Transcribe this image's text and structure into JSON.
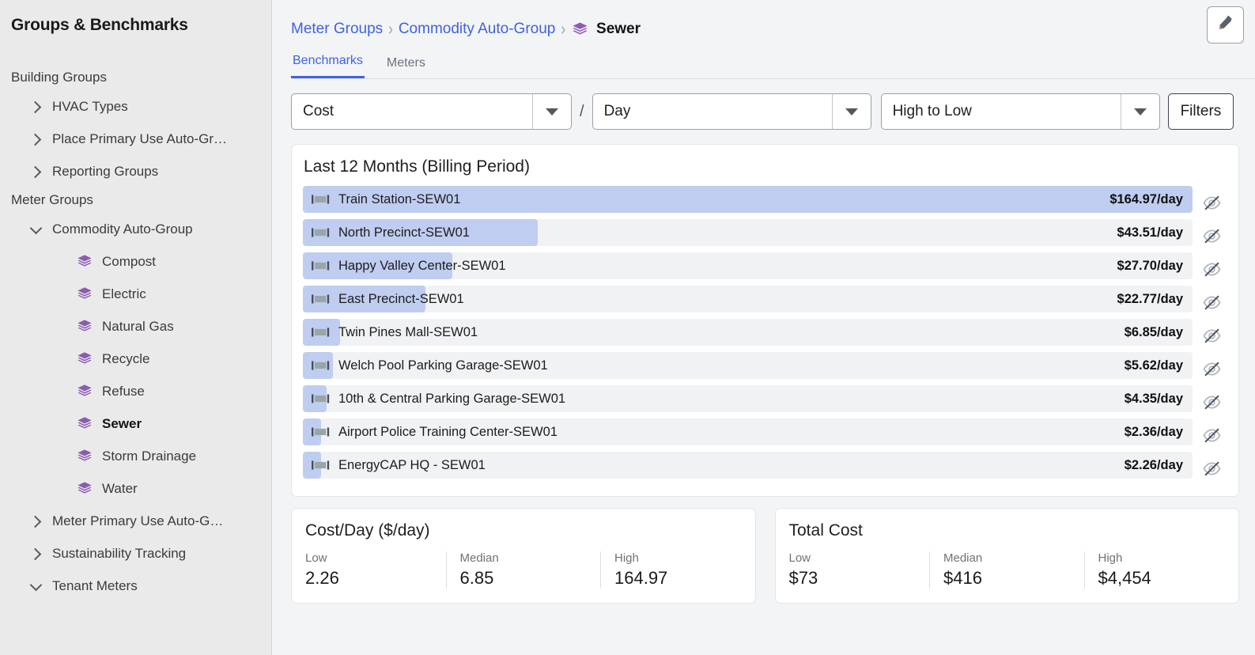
{
  "sidebar": {
    "title": "Groups & Benchmarks",
    "sections": [
      {
        "label": "Building Groups",
        "items": [
          {
            "label": "HVAC Types",
            "state": "collapsed",
            "level": 1
          },
          {
            "label": "Place Primary Use Auto-Gr…",
            "state": "collapsed",
            "level": 1
          },
          {
            "label": "Reporting Groups",
            "state": "collapsed",
            "level": 1
          }
        ]
      },
      {
        "label": "Meter Groups",
        "items": [
          {
            "label": "Commodity Auto-Group",
            "state": "expanded",
            "level": 1
          },
          {
            "label": "Compost",
            "state": "leaf",
            "level": 2
          },
          {
            "label": "Electric",
            "state": "leaf",
            "level": 2
          },
          {
            "label": "Natural Gas",
            "state": "leaf",
            "level": 2
          },
          {
            "label": "Recycle",
            "state": "leaf",
            "level": 2
          },
          {
            "label": "Refuse",
            "state": "leaf",
            "level": 2
          },
          {
            "label": "Sewer",
            "state": "leaf",
            "level": 2,
            "active": true
          },
          {
            "label": "Storm Drainage",
            "state": "leaf",
            "level": 2
          },
          {
            "label": "Water",
            "state": "leaf",
            "level": 2
          },
          {
            "label": "Meter Primary Use Auto-G…",
            "state": "collapsed",
            "level": 1
          },
          {
            "label": "Sustainability Tracking",
            "state": "collapsed",
            "level": 1
          },
          {
            "label": "Tenant Meters",
            "state": "expanded",
            "level": 1
          }
        ]
      }
    ]
  },
  "breadcrumb": {
    "items": [
      "Meter Groups",
      "Commodity Auto-Group"
    ],
    "separator": "›",
    "current": "Sewer"
  },
  "header": {
    "edit_icon": "pencil-icon"
  },
  "tabs": [
    {
      "label": "Benchmarks",
      "active": true
    },
    {
      "label": "Meters",
      "active": false
    }
  ],
  "controls": {
    "metric": "Cost",
    "divider": "/",
    "period": "Day",
    "sort": "High to Low",
    "filters_label": "Filters"
  },
  "benchmark_card": {
    "title": "Last 12 Months (Billing Period)"
  },
  "chart_data": {
    "type": "bar",
    "orientation": "horizontal",
    "title": "Last 12 Months (Billing Period)",
    "xlabel": "",
    "ylabel": "",
    "unit": "$/day",
    "sort": "High to Low",
    "categories": [
      "Train Station-SEW01",
      "North Precinct-SEW01",
      "Happy Valley Center-SEW01",
      "East Precinct-SEW01",
      "Twin Pines Mall-SEW01",
      "Welch Pool Parking Garage-SEW01",
      "10th & Central Parking Garage-SEW01",
      "Airport Police Training Center-SEW01",
      "EnergyCAP HQ - SEW01"
    ],
    "values": [
      164.97,
      43.51,
      27.7,
      22.77,
      6.85,
      5.62,
      4.35,
      2.36,
      2.26
    ],
    "value_labels": [
      "$164.97/day",
      "$43.51/day",
      "$27.70/day",
      "$22.77/day",
      "$6.85/day",
      "$5.62/day",
      "$4.35/day",
      "$2.36/day",
      "$2.26/day"
    ],
    "xlim": [
      0,
      164.97
    ],
    "grid": false,
    "legend": false,
    "bar_color": "#bfcdf0",
    "row_color": "#f1f2f4"
  },
  "stat_cards": [
    {
      "title": "Cost/Day ($/day)",
      "cols": [
        {
          "label": "Low",
          "value": "2.26"
        },
        {
          "label": "Median",
          "value": "6.85"
        },
        {
          "label": "High",
          "value": "164.97"
        }
      ]
    },
    {
      "title": "Total Cost",
      "cols": [
        {
          "label": "Low",
          "value": "$73"
        },
        {
          "label": "Median",
          "value": "$416"
        },
        {
          "label": "High",
          "value": "$4,454"
        }
      ]
    }
  ],
  "colors": {
    "accent": "#3e63dd",
    "stack_purple": "#8e5bb0",
    "bar": "#bfcdf0",
    "sidebar_bg": "#eaeaea"
  }
}
